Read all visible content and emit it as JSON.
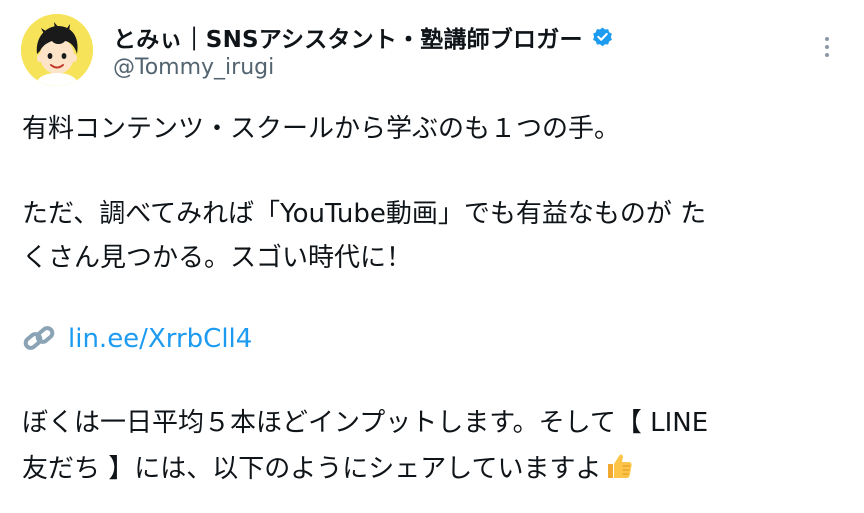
{
  "author": {
    "display_name": "とみぃ｜SNSアシスタント・塾講師ブロガー",
    "handle": "@Tommy_irugi"
  },
  "icons": {
    "verified": "verified-badge-icon",
    "more": "more-options-icon",
    "link": "link-icon",
    "emoji": "thumbs-up-emoji"
  },
  "colors": {
    "verified_blue": "#1d9bf0",
    "link_blue": "#1d9bf0",
    "text": "#0f1419",
    "muted": "#536471"
  },
  "tweet": {
    "line1": "有料コンテンツ・スクールから学ぶのも１つの手。",
    "line2": "ただ、調べてみれば「YouTube動画」でも有益なものが たくさん見つかる。スゴい時代に！",
    "link_text": "lin.ee/XrrbCll4",
    "line4": "ぼくは一日平均５本ほどインプットします。そして【 LINE友だち 】には、以下のようにシェアしていますよ"
  }
}
